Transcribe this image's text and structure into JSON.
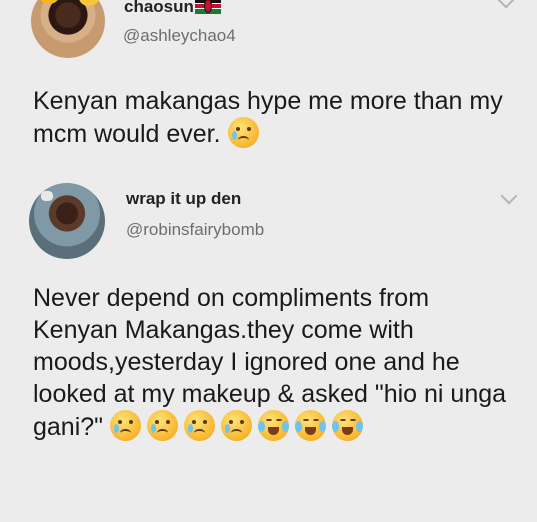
{
  "tweets": [
    {
      "display_name": "chaosun",
      "flag_icon": "kenya-flag-icon",
      "handle": "@ashleychao4",
      "text": "Kenyan makangas hype me more than my mcm would ever.",
      "emojis": [
        "disappointed-relieved-emoji"
      ]
    },
    {
      "display_name": "wrap it up den",
      "handle": "@robinsfairybomb",
      "text": "Never depend on compliments from Kenyan Makangas.they come with moods,yesterday I ignored one and he looked at my makeup & asked \"hio ni unga gani?\"",
      "emojis": [
        "disappointed-relieved-emoji",
        "disappointed-relieved-emoji",
        "disappointed-relieved-emoji",
        "disappointed-relieved-emoji",
        "tears-of-joy-emoji",
        "tears-of-joy-emoji",
        "tears-of-joy-emoji"
      ]
    }
  ],
  "colors": {
    "background": "#ececec",
    "text": "#1a1a1a",
    "handle": "#6e6e6e",
    "chevron": "#b5b5b5"
  }
}
